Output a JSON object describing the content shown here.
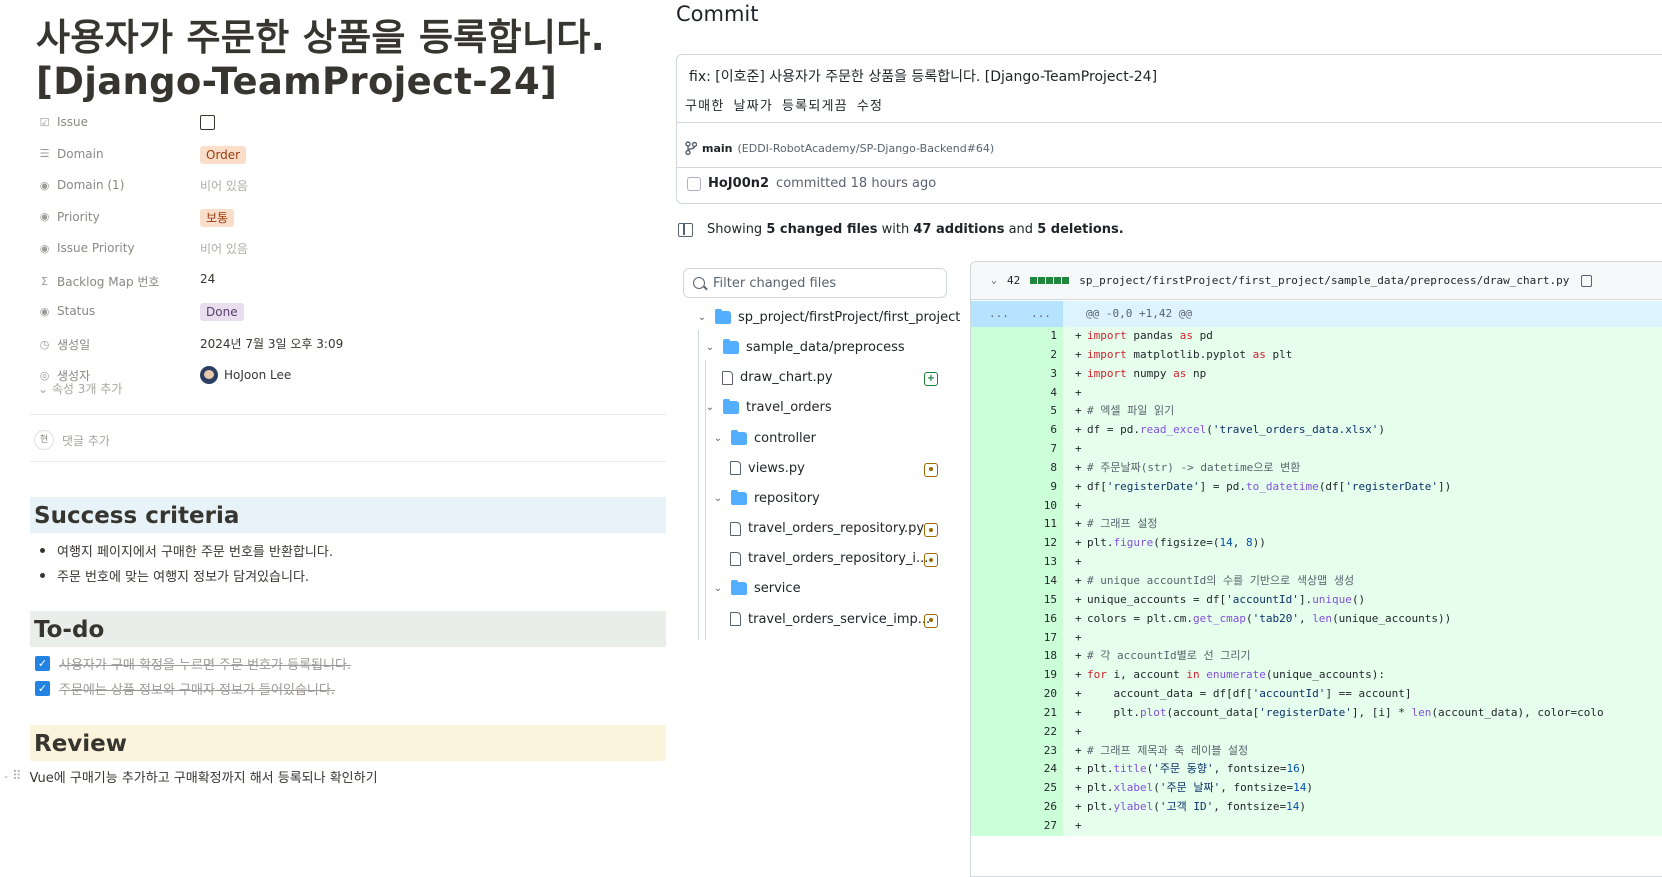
{
  "notion": {
    "title": "사용자가 주문한 상품을 등록합니다. [Django-TeamProject-24]",
    "props": [
      {
        "name": "Issue",
        "icon": "checkbox-icon",
        "type": "checkbox",
        "value": ""
      },
      {
        "name": "Domain",
        "icon": "list-icon",
        "type": "tag-orange",
        "value": "Order"
      },
      {
        "name": "Domain (1)",
        "icon": "select-icon",
        "type": "empty",
        "value": "비어 있음"
      },
      {
        "name": "Priority",
        "icon": "select-icon",
        "type": "tag-orange",
        "value": "보통"
      },
      {
        "name": "Issue Priority",
        "icon": "select-icon",
        "type": "empty",
        "value": "비어 있음"
      },
      {
        "name": "Backlog Map 번호",
        "icon": "sigma-icon",
        "type": "text",
        "value": "24"
      },
      {
        "name": "Status",
        "icon": "select-icon",
        "type": "tag-purple",
        "value": "Done"
      },
      {
        "name": "생성일",
        "icon": "clock-icon",
        "type": "text",
        "value": "2024년 7월 3일 오후 3:09"
      },
      {
        "name": "생성자",
        "icon": "person-icon",
        "type": "person",
        "value": "HoJoon Lee"
      }
    ],
    "more_props": "속성 3개 추가",
    "comment_avatar": "현",
    "comment_placeholder": "댓글 추가",
    "sections": {
      "success": "Success criteria",
      "todo": "To-do",
      "review": "Review"
    },
    "success_items": [
      "여행지 페이지에서 구매한 주문 번호를 반환합니다.",
      "주문 번호에 맞는 여행지 정보가 담겨있습니다."
    ],
    "todo_items": [
      "사용자가 구매 확정을 누르면 주문 번호가 등록됩니다.",
      "주문에는 상품 정보와 구매자 정보가 들어있습니다."
    ],
    "review_text": "Vue에 구매기능 추가하고 구매확정까지 해서 등록되나 확인하기"
  },
  "github": {
    "heading": "Commit",
    "commit_title": "fix: [이호준] 사용자가 주문한 상품을 등록합니다. [Django-TeamProject-24]",
    "commit_desc": "구매한 날짜가 등록되게끔 수정",
    "branch": "main",
    "branch_ref": "(EDDI-RobotAcademy/SP-Django-Backend#64)",
    "author": "HoJ00n2",
    "committed": "committed 18 hours ago",
    "summary": {
      "prefix": "Showing",
      "files": "5 changed files",
      "with": "with",
      "additions": "47 additions",
      "and": "and",
      "deletions": "5 deletions."
    },
    "filter_placeholder": "Filter changed files",
    "tree": [
      {
        "label": "sp_project/firstProject/first_project",
        "kind": "folder"
      },
      {
        "label": "sample_data/preprocess",
        "kind": "folder"
      },
      {
        "label": "draw_chart.py",
        "kind": "file",
        "status": "added"
      },
      {
        "label": "travel_orders",
        "kind": "folder"
      },
      {
        "label": "controller",
        "kind": "folder"
      },
      {
        "label": "views.py",
        "kind": "file",
        "status": "modified"
      },
      {
        "label": "repository",
        "kind": "folder"
      },
      {
        "label": "travel_orders_repository.py",
        "kind": "file",
        "status": "modified"
      },
      {
        "label": "travel_orders_repository_i...",
        "kind": "file",
        "status": "modified"
      },
      {
        "label": "service",
        "kind": "folder"
      },
      {
        "label": "travel_orders_service_imp...",
        "kind": "file",
        "status": "modified"
      }
    ],
    "diff": {
      "count": "42",
      "path": "sp_project/firstProject/first_project/sample_data/preprocess/draw_chart.py",
      "hunk_old": "...",
      "hunk_new": "...",
      "hunk": "@@ -0,0 +1,42 @@",
      "lines": [
        "import pandas as pd",
        "import matplotlib.pyplot as plt",
        "import numpy as np",
        "",
        "# 엑셀 파일 읽기",
        "df = pd.read_excel('travel_orders_data.xlsx')",
        "",
        "# 주문날짜(str) -> datetime으로 변환",
        "df['registerDate'] = pd.to_datetime(df['registerDate'])",
        "",
        "# 그래프 설정",
        "plt.figure(figsize=(14, 8))",
        "",
        "# unique accountId의 수를 기반으로 색상맵 생성",
        "unique_accounts = df['accountId'].unique()",
        "colors = plt.cm.get_cmap('tab20', len(unique_accounts))",
        "",
        "# 각 accountId별로 선 그리기",
        "for i, account in enumerate(unique_accounts):",
        "    account_data = df[df['accountId'] == account]",
        "    plt.plot(account_data['registerDate'], [i] * len(account_data), color=colo",
        "",
        "# 그래프 제목과 축 레이블 설정",
        "plt.title('주문 동향', fontsize=16)",
        "plt.xlabel('주문 날짜', fontsize=14)",
        "plt.ylabel('고객 ID', fontsize=14)",
        ""
      ]
    }
  }
}
